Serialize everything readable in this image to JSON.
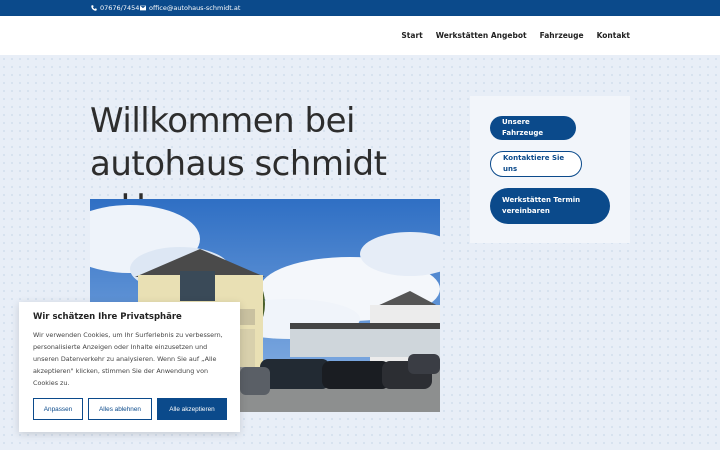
{
  "topbar": {
    "phone": "07676/7454",
    "email": "office@autohaus-schmidt.at"
  },
  "nav": {
    "items": [
      "Start",
      "Werkstätten Angebot",
      "Fahrzeuge",
      "Kontakt"
    ]
  },
  "hero": {
    "title_line1": "Willkommen bei",
    "title_line2": "autohaus schmidt e.U."
  },
  "sidebar": {
    "btn1": "Unsere Fahrzeuge",
    "btn2": "Kontaktiere Sie uns",
    "btn3_line1": "Werkstätten Termin",
    "btn3_line2": "vereinbaren"
  },
  "cookie": {
    "title": "Wir schätzen Ihre Privatsphäre",
    "text": "Wir verwenden Cookies, um Ihr Surferlebnis zu verbessern, personalisierte Anzeigen oder Inhalte einzusetzen und unseren Datenverkehr zu analysieren. Wenn Sie auf „Alle akzeptieren\" klicken, stimmen Sie der Anwendung von Cookies zu.",
    "customize": "Anpassen",
    "reject": "Alles ablehnen",
    "accept": "Alle akzeptieren"
  },
  "colors": {
    "brand": "#0b4a8b"
  }
}
